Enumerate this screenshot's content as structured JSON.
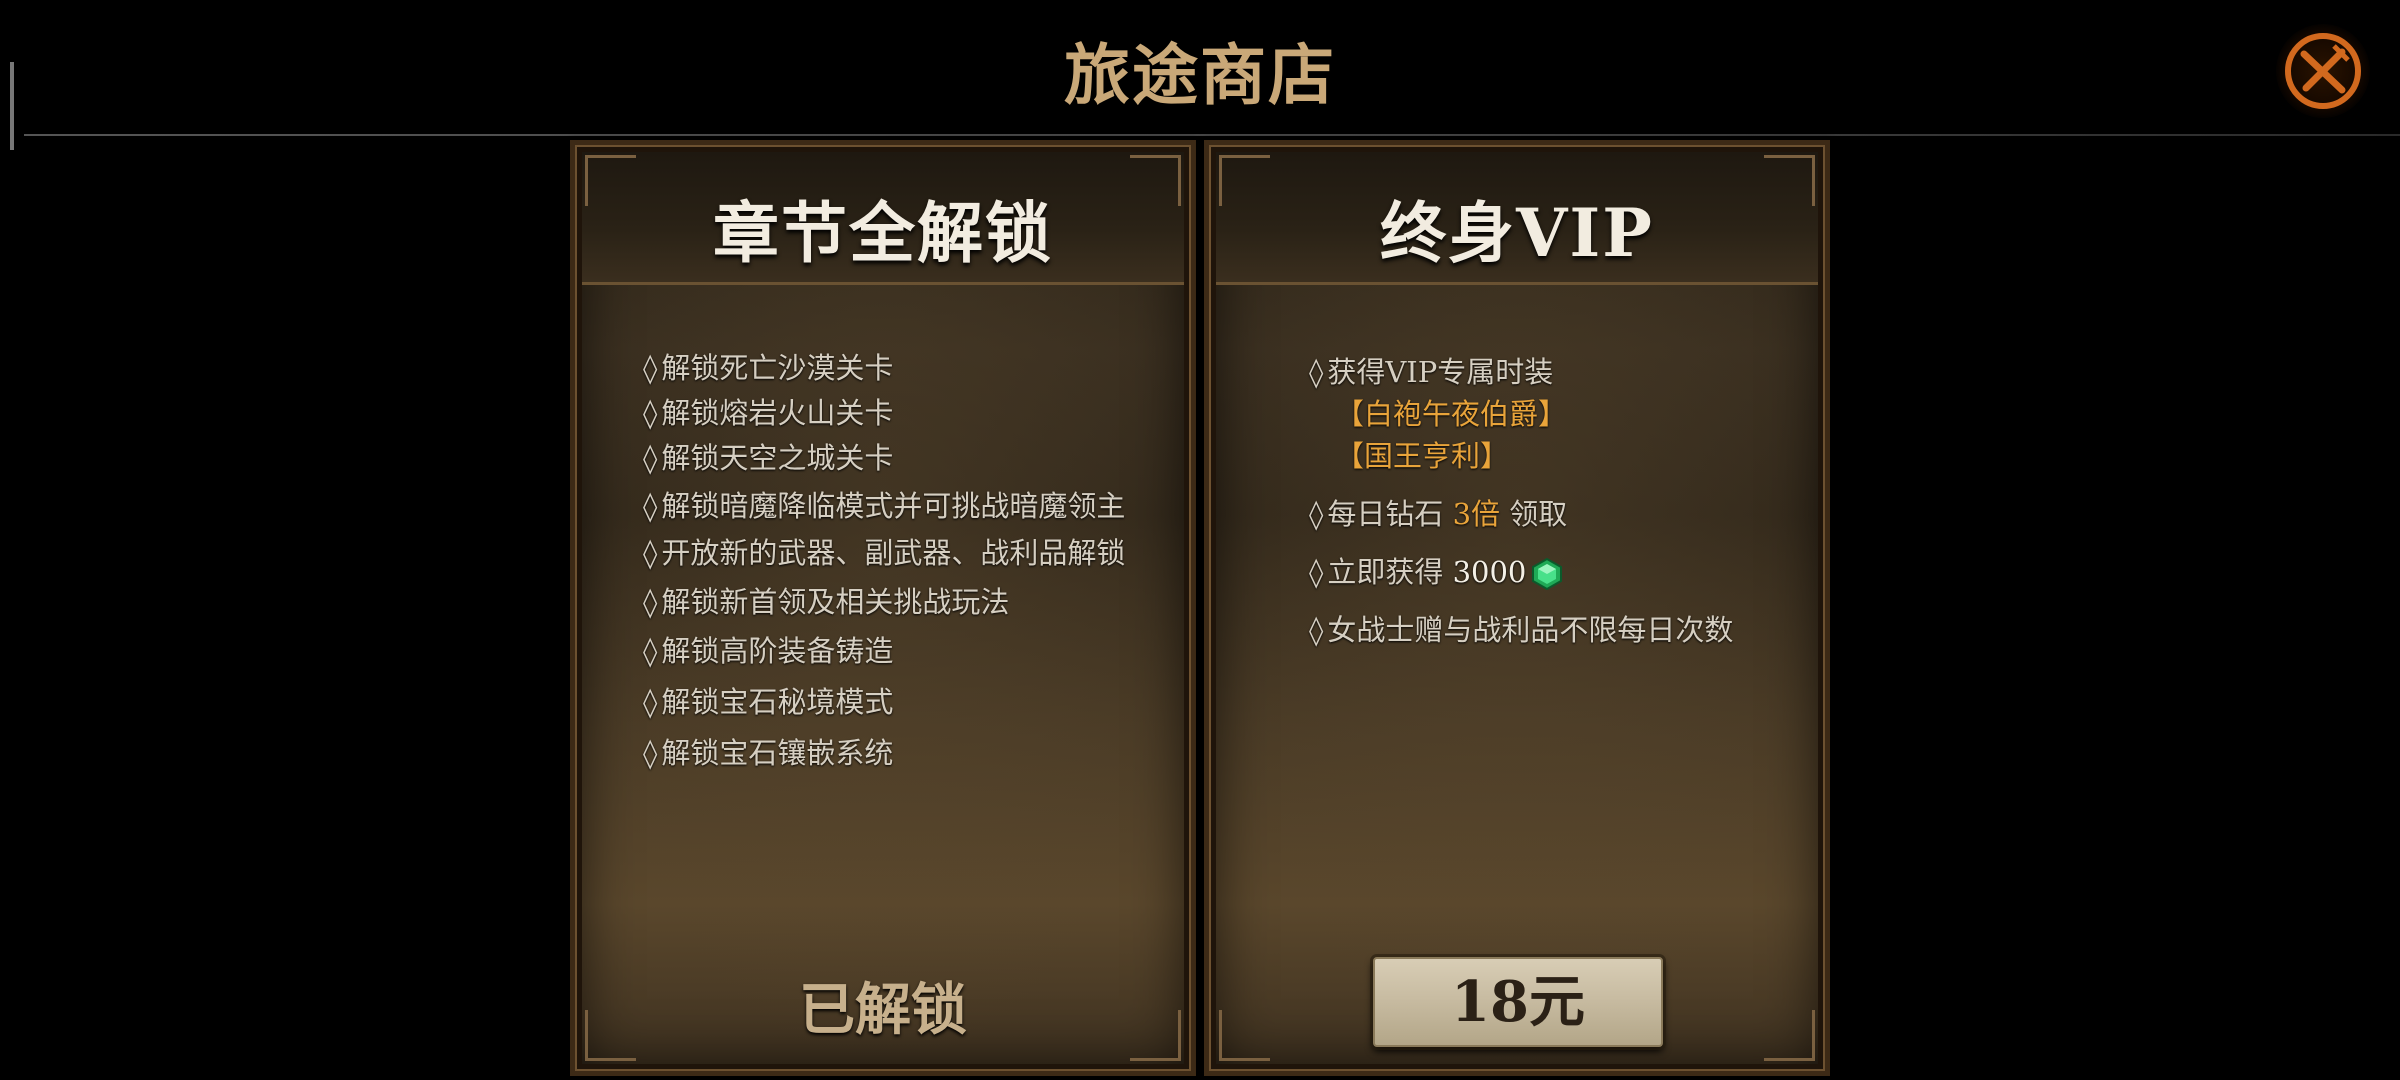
{
  "header": {
    "title": "旅途商店"
  },
  "left_panel": {
    "title": "章节全解锁",
    "features": [
      "解锁死亡沙漠关卡",
      "解锁熔岩火山关卡",
      "解锁天空之城关卡",
      "解锁暗魔降临模式并可挑战暗魔领主",
      "开放新的武器、副武器、战利品解锁",
      "解锁新首领及相关挑战玩法",
      "解锁高阶装备铸造",
      "解锁宝石秘境模式",
      "解锁宝石镶嵌系统"
    ],
    "status": "已解锁"
  },
  "right_panel": {
    "title": "终身VIP",
    "feature1": {
      "text": "获得VIP专属时装",
      "items": [
        "【白袍午夜伯爵】",
        "【国王亨利】"
      ]
    },
    "feature2": {
      "prefix": "每日钻石 ",
      "highlight": "3倍",
      "suffix": " 领取"
    },
    "feature3": {
      "prefix": "立即获得 ",
      "amount": "3000"
    },
    "feature4": "女战士赠与战利品不限每日次数",
    "price": "18元"
  },
  "bullet": "◊",
  "icons": {
    "close": "close-x-icon",
    "gem": "emerald-gem-icon"
  },
  "colors": {
    "title": "#c9a878",
    "highlight": "#e9a43a",
    "close": "#d2691e",
    "gem": "#2ecc71"
  }
}
